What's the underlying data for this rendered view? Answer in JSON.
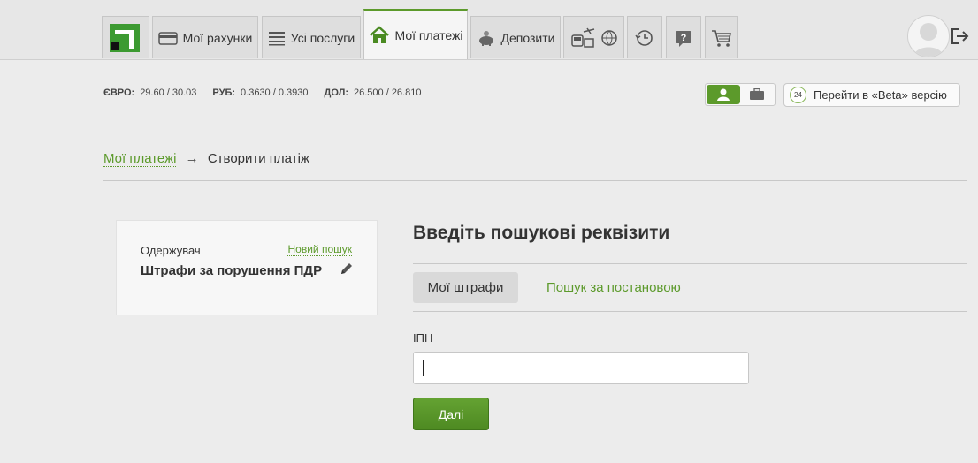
{
  "nav": {
    "accounts_label": "Мої рахунки",
    "services_label": "Усі послуги",
    "payments_label": "Мої платежі",
    "deposits_label": "Депозити"
  },
  "rates": {
    "eur_label": "ЄВРО:",
    "eur_value": "29.60 / 30.03",
    "rub_label": "РУБ:",
    "rub_value": "0.3630 / 0.3930",
    "usd_label": "ДОЛ:",
    "usd_value": "26.500 / 26.810"
  },
  "beta": {
    "badge": "24",
    "label": "Перейти в «Beta» версію"
  },
  "breadcrumb": {
    "parent": "Мої платежі",
    "arrow": "→",
    "current": "Створити платіж"
  },
  "recipient": {
    "label": "Одержувач",
    "new_search": "Новий пошук",
    "name": "Штрафи за порушення ПДР"
  },
  "form": {
    "title": "Введіть пошукові реквізити",
    "tabs": [
      {
        "label": "Мої штрафи",
        "active": true
      },
      {
        "label": "Пошук за постановою",
        "active": false
      }
    ],
    "ipn_label": "ІПН",
    "ipn_value": "",
    "next_label": "Далі"
  },
  "colors": {
    "accent": "#5c9a2b",
    "logo": "#3c9a31",
    "background": "#ececec"
  },
  "icons": [
    "card-icon",
    "list-icon",
    "home-icon",
    "piggy-bank-icon",
    "transport-icon",
    "globe-icon",
    "exchange-icon",
    "help-icon",
    "cart-icon",
    "user-icon",
    "briefcase-icon",
    "logout-icon",
    "pencil-icon"
  ]
}
